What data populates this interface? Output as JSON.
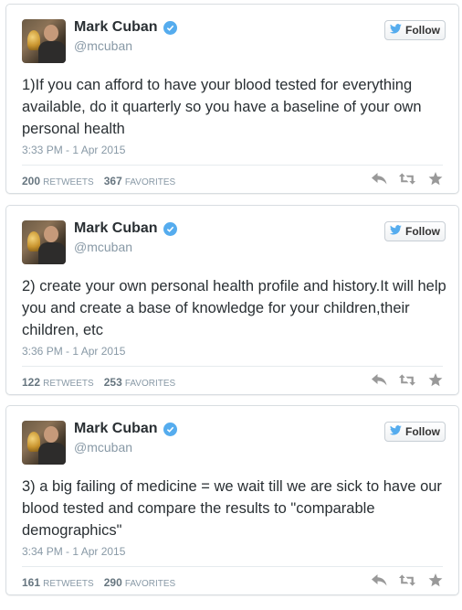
{
  "tweets": [
    {
      "name": "Mark Cuban",
      "handle": "@mcuban",
      "follow_label": "Follow",
      "text": "1)If you can afford to have your blood tested for everything available, do it quarterly so you have a baseline of your own personal health",
      "time": "3:33 PM - 1 Apr 2015",
      "retweets": "200",
      "retweets_label": "RETWEETS",
      "favorites": "367",
      "favorites_label": "FAVORITES"
    },
    {
      "name": "Mark Cuban",
      "handle": "@mcuban",
      "follow_label": "Follow",
      "text": "2) create your own personal health profile and history.It will help you and create a base of knowledge for your children,their children, etc",
      "time": "3:36 PM - 1 Apr 2015",
      "retweets": "122",
      "retweets_label": "RETWEETS",
      "favorites": "253",
      "favorites_label": "FAVORITES"
    },
    {
      "name": "Mark Cuban",
      "handle": "@mcuban",
      "follow_label": "Follow",
      "text": "3) a big failing of medicine = we wait till we are sick to have our blood tested and compare the results to \"comparable demographics\"",
      "time": "3:34 PM - 1 Apr 2015",
      "retweets": "161",
      "retweets_label": "RETWEETS",
      "favorites": "290",
      "favorites_label": "FAVORITES"
    }
  ],
  "icons": {
    "verified": "verified-badge-icon",
    "follow": "twitter-bird-icon",
    "reply": "reply-icon",
    "retweet": "retweet-icon",
    "favorite": "star-icon"
  },
  "colors": {
    "accent": "#55acee",
    "muted": "#8899a6",
    "text": "#292f33"
  }
}
